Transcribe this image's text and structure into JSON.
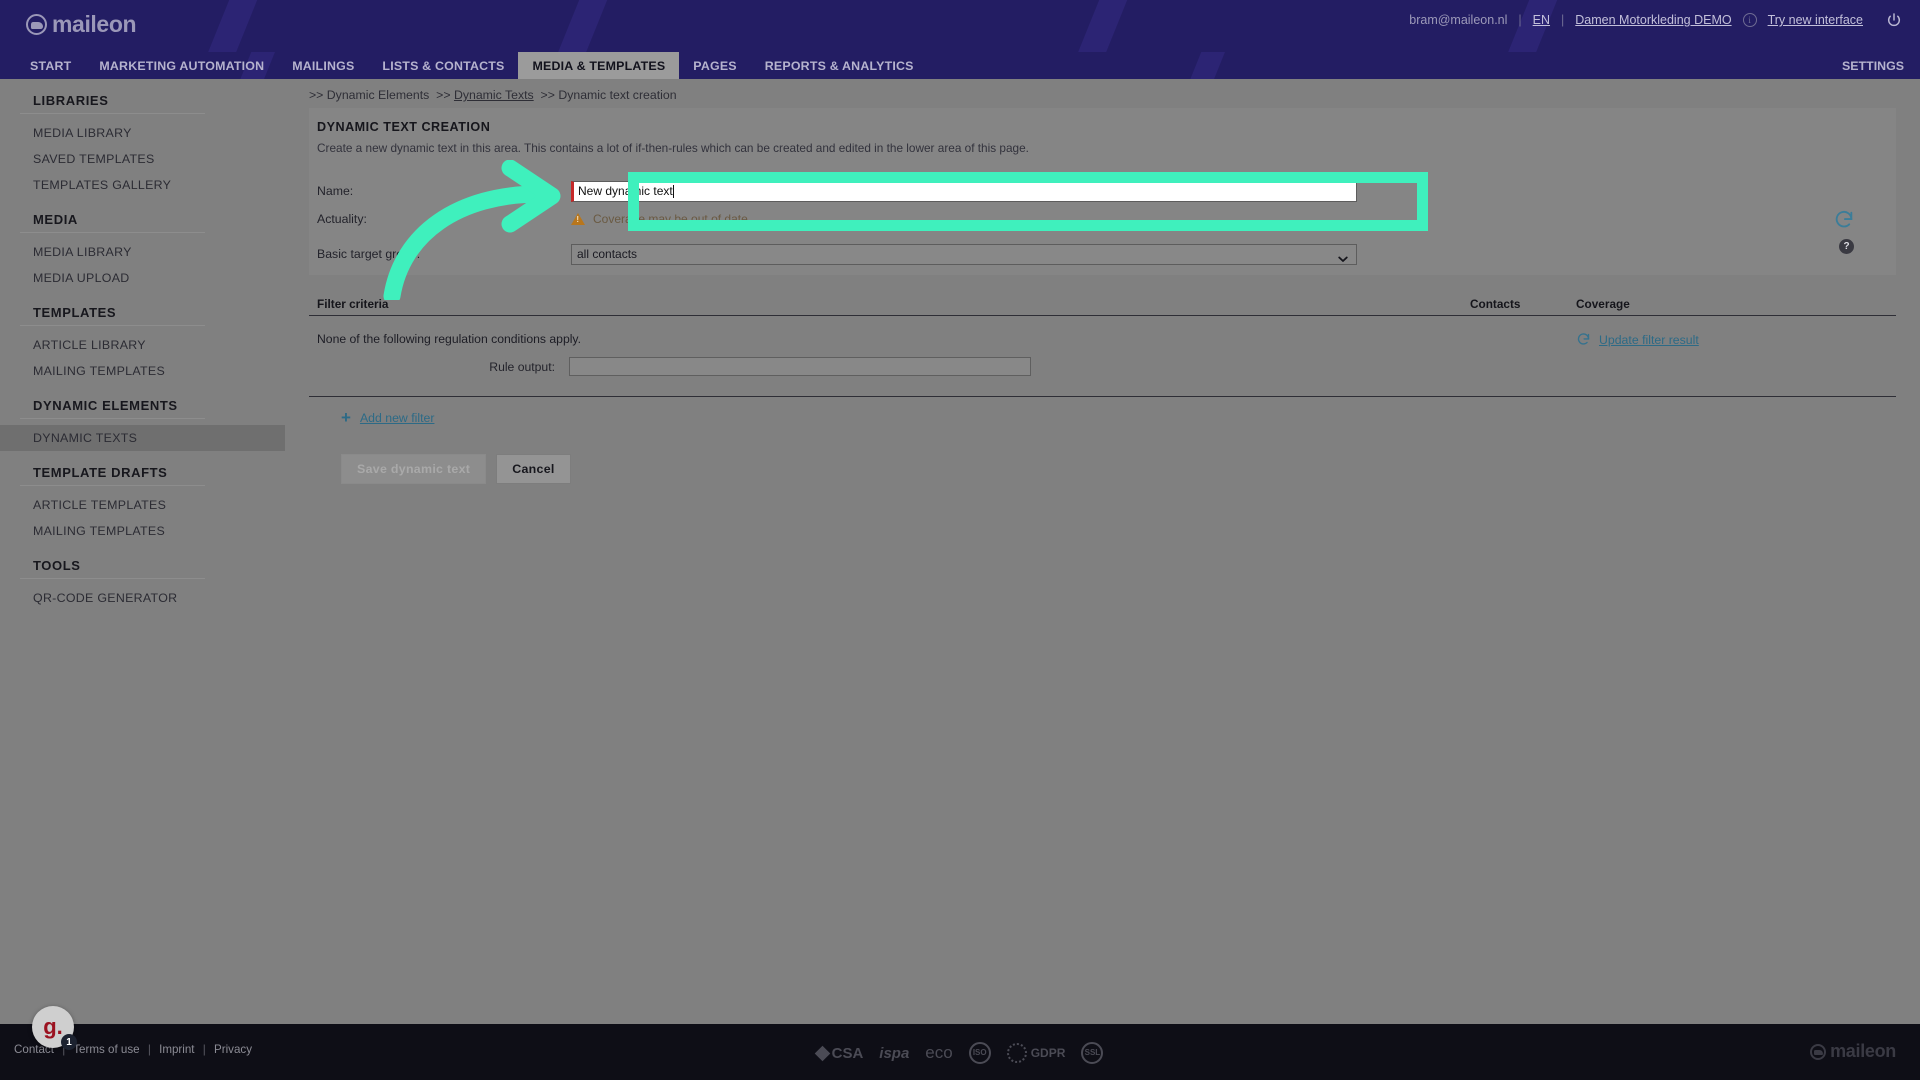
{
  "brand": {
    "name": "maileon",
    "logo_icon": "maileon-logo-icon"
  },
  "topbar": {
    "user_email": "bram@maileon.nl",
    "separator": "|",
    "language": "EN",
    "account": "Damen Motorkleding DEMO",
    "info_icon": "info-circle-icon",
    "try_new_interface": "Try new interface",
    "power_icon": "power-icon"
  },
  "nav": {
    "items": [
      {
        "label": "START",
        "active": false
      },
      {
        "label": "MARKETING AUTOMATION",
        "active": false
      },
      {
        "label": "MAILINGS",
        "active": false
      },
      {
        "label": "LISTS & CONTACTS",
        "active": false
      },
      {
        "label": "MEDIA & TEMPLATES",
        "active": true
      },
      {
        "label": "PAGES",
        "active": false
      },
      {
        "label": "REPORTS & ANALYTICS",
        "active": false
      }
    ],
    "settings_label": "SETTINGS"
  },
  "sidebar": {
    "groups": [
      {
        "head": "LIBRARIES",
        "items": [
          {
            "label": "MEDIA LIBRARY",
            "active": false
          },
          {
            "label": "SAVED TEMPLATES",
            "active": false
          },
          {
            "label": "TEMPLATES GALLERY",
            "active": false
          }
        ]
      },
      {
        "head": "MEDIA",
        "items": [
          {
            "label": "MEDIA LIBRARY",
            "active": false
          },
          {
            "label": "MEDIA UPLOAD",
            "active": false
          }
        ]
      },
      {
        "head": "TEMPLATES",
        "items": [
          {
            "label": "ARTICLE LIBRARY",
            "active": false
          },
          {
            "label": "MAILING TEMPLATES",
            "active": false
          }
        ]
      },
      {
        "head": "DYNAMIC ELEMENTS",
        "items": [
          {
            "label": "DYNAMIC TEXTS",
            "active": true
          }
        ]
      },
      {
        "head": "TEMPLATE DRAFTS",
        "items": [
          {
            "label": "ARTICLE TEMPLATES",
            "active": false
          },
          {
            "label": "MAILING TEMPLATES",
            "active": false
          }
        ]
      },
      {
        "head": "TOOLS",
        "items": [
          {
            "label": "QR-CODE GENERATOR",
            "active": false
          }
        ]
      }
    ]
  },
  "breadcrumb": {
    "prefix": ">>",
    "item1": "Dynamic Elements",
    "item2": "Dynamic Texts",
    "item3": "Dynamic text creation"
  },
  "panel": {
    "title": "DYNAMIC TEXT CREATION",
    "subtitle": "Create a new dynamic text in this area. This contains a lot of if-then-rules which can be created and edited in the lower area of this page."
  },
  "form": {
    "name_label": "Name:",
    "name_value": "New dynamic text",
    "name_placeholder": "",
    "actuality_label": "Actuality:",
    "actuality_warning": "Coverage may be out of date",
    "warning_icon": "warning-triangle-icon",
    "refresh_icon": "refresh-icon",
    "target_group_label": "Basic target group:",
    "target_group_value": "all contacts",
    "target_group_options": [
      "all contacts"
    ],
    "help_icon": "help-circle-icon",
    "help_icon_text": "?"
  },
  "filter": {
    "col_criteria": "Filter criteria",
    "col_contacts": "Contacts",
    "col_coverage": "Coverage",
    "none_text": "None of the following regulation conditions apply.",
    "rule_output_label": "Rule output:",
    "rule_output_value": "",
    "update_icon": "refresh-icon",
    "update_label": "Update filter result",
    "add_filter_icon": "plus-icon",
    "add_filter_label": "Add new filter"
  },
  "actions": {
    "save_label": "Save dynamic text",
    "save_disabled": true,
    "cancel_label": "Cancel"
  },
  "footer": {
    "links": [
      "Contact",
      "Terms of use",
      "Imprint",
      "Privacy"
    ],
    "divider": "|",
    "certs": [
      "CSA",
      "ispa",
      "eco",
      "ISO",
      "GDPR",
      "SSL"
    ],
    "logo": "maileon"
  },
  "widget": {
    "label": "g.",
    "badge": "1"
  },
  "annotation": {
    "highlight_color": "#3ff0bd",
    "arrow_icon": "curved-arrow-right-icon",
    "target": "name-input"
  }
}
